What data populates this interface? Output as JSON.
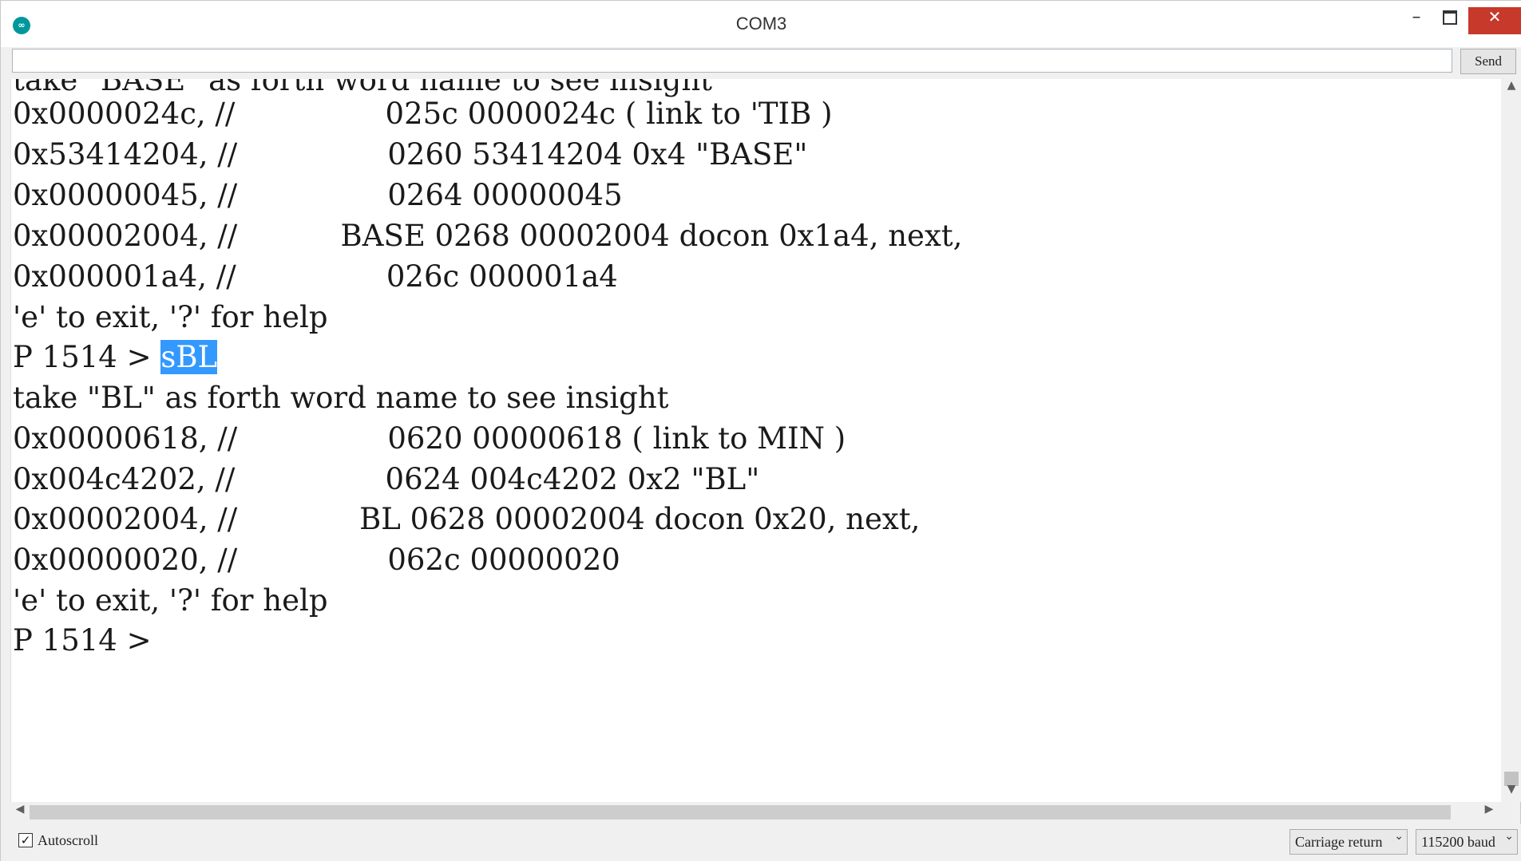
{
  "window": {
    "title": "COM3",
    "app_icon": "arduino-icon",
    "controls": {
      "minimize": "–",
      "maximize": "maximize-icon",
      "close": "✕"
    }
  },
  "send_bar": {
    "input_value": "",
    "send_label": "Send"
  },
  "output": {
    "lines": [
      "take \"BASE\" as forth word name to see insight",
      "0x0000024c, //                025c 0000024c ( link to 'TIB )",
      "0x53414204, //                0260 53414204 0x4 \"BASE\"",
      "0x00000045, //                0264 00000045",
      "0x00002004, //           BASE 0268 00002004 docon 0x1a4, next,",
      "0x000001a4, //                026c 000001a4",
      "'e' to exit, '?' for help",
      "P 1514 > ",
      "take \"BL\" as forth word name to see insight",
      "0x00000618, //                0620 00000618 ( link to MIN )",
      "0x004c4202, //                0624 004c4202 0x2 \"BL\"",
      "0x00002004, //             BL 0628 00002004 docon 0x20, next,",
      "0x00000020, //                062c 00000020",
      "'e' to exit, '?' for help",
      "P 1514 >"
    ],
    "selected_text": "sBL"
  },
  "bottom_bar": {
    "autoscroll_label": "Autoscroll",
    "autoscroll_checked": true,
    "line_ending": "Carriage return",
    "baud": "115200 baud"
  },
  "colors": {
    "selection": "#3399ff",
    "close_button": "#c7392b"
  }
}
